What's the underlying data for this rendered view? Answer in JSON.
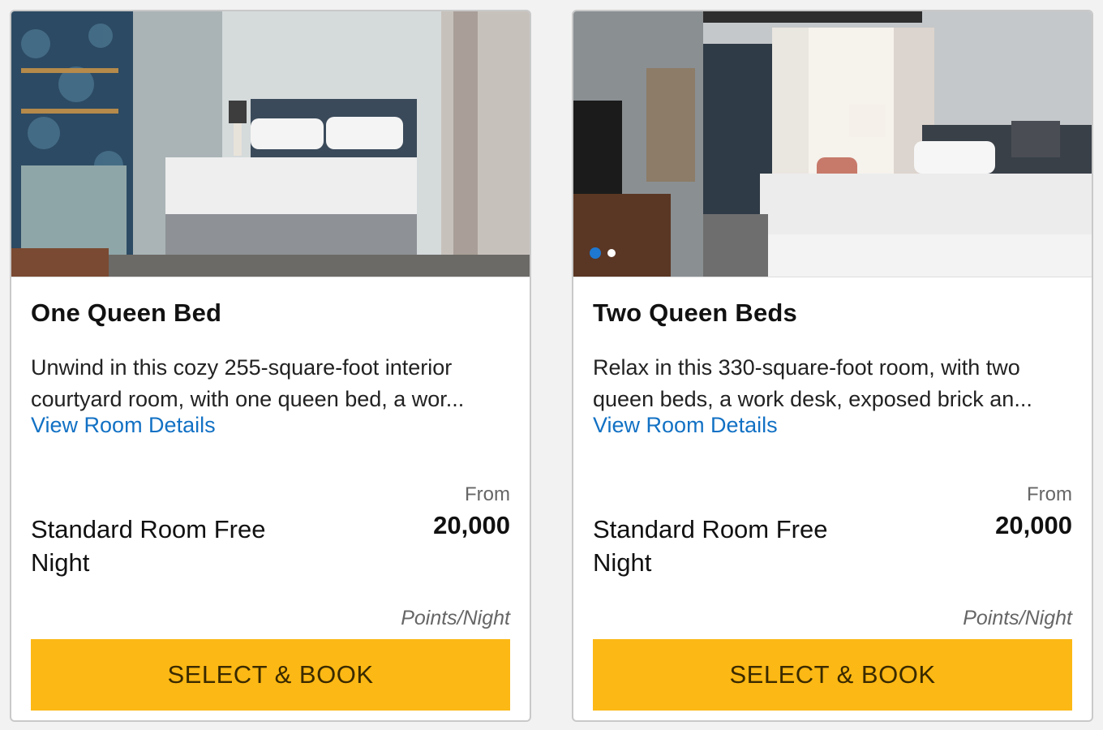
{
  "rooms": [
    {
      "title": "One Queen Bed",
      "description": "Unwind in this cozy 255-square-foot interior courtyard room, with one queen bed, a wor...",
      "details_link": "View Room Details",
      "from_label": "From",
      "rate_name": "Standard Room Free Night",
      "points": "20,000",
      "unit": "Points/Night",
      "button": "SELECT & BOOK"
    },
    {
      "title": "Two Queen Beds",
      "description": "Relax in this 330-square-foot room, with two queen beds, a work desk, exposed brick an...",
      "details_link": "View Room Details",
      "from_label": "From",
      "rate_name": "Standard Room Free Night",
      "points": "20,000",
      "unit": "Points/Night",
      "button": "SELECT & BOOK"
    }
  ],
  "colors": {
    "accent_button": "#fcb814",
    "link": "#1271c4",
    "carousel_active": "#1f78d1"
  }
}
